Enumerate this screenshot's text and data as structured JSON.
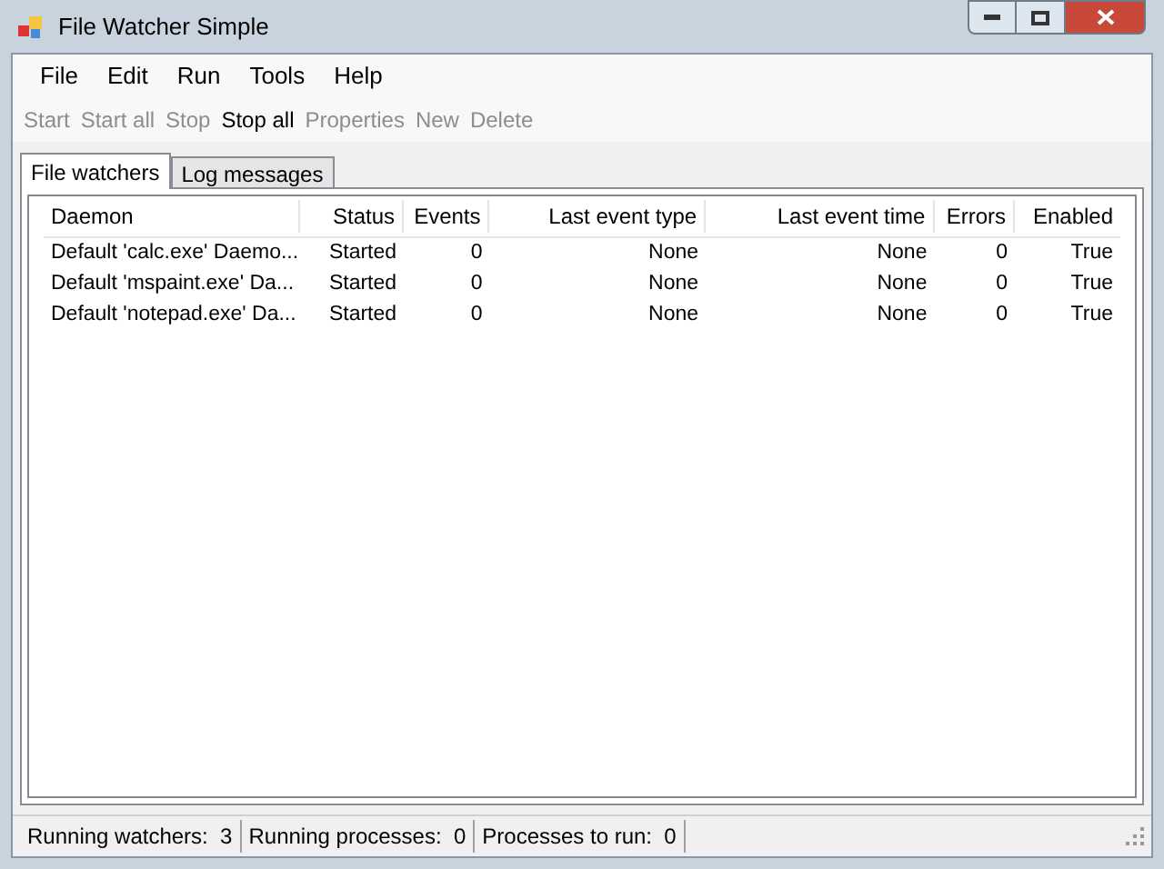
{
  "window": {
    "title": "File Watcher Simple"
  },
  "menu": [
    "File",
    "Edit",
    "Run",
    "Tools",
    "Help"
  ],
  "toolbar": [
    {
      "label": "Start",
      "disabled": true
    },
    {
      "label": "Start all",
      "disabled": true
    },
    {
      "label": "Stop",
      "disabled": true
    },
    {
      "label": "Stop all",
      "disabled": false
    },
    {
      "label": "Properties",
      "disabled": true
    },
    {
      "label": "New",
      "disabled": true
    },
    {
      "label": "Delete",
      "disabled": true
    }
  ],
  "tabs": [
    {
      "label": "File watchers",
      "selected": true
    },
    {
      "label": "Log messages",
      "selected": false
    }
  ],
  "table": {
    "columns": [
      "Daemon",
      "Status",
      "Events",
      "Last event type",
      "Last event time",
      "Errors",
      "Enabled"
    ],
    "rows": [
      [
        "Default 'calc.exe' Daemo...",
        "Started",
        "0",
        "None",
        "None",
        "0",
        "True"
      ],
      [
        "Default 'mspaint.exe' Da...",
        "Started",
        "0",
        "None",
        "None",
        "0",
        "True"
      ],
      [
        "Default 'notepad.exe' Da...",
        "Started",
        "0",
        "None",
        "None",
        "0",
        "True"
      ]
    ]
  },
  "status_bar": [
    "Running watchers:  3",
    "Running processes:  0",
    "Processes to run:  0"
  ]
}
